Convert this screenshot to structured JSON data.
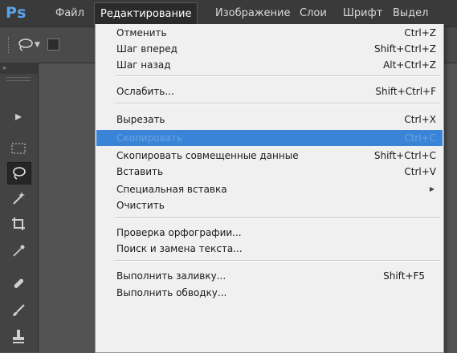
{
  "app": {
    "logo": "Ps"
  },
  "menubar": [
    "Файл",
    "Редактирование",
    "Изображение",
    "Слои",
    "Шрифт",
    "Выдел"
  ],
  "tool_panel": {
    "collapse": "»"
  },
  "tools": [
    {
      "icon": "move-tool-icon",
      "glyph": "▸"
    },
    {
      "icon": "marquee-tool-icon",
      "glyph": "⬚"
    },
    {
      "icon": "lasso-tool-icon",
      "glyph": "ℓ"
    },
    {
      "icon": "magic-wand-tool-icon",
      "glyph": "✶"
    },
    {
      "icon": "crop-tool-icon",
      "glyph": "⌗"
    },
    {
      "icon": "eyedropper-tool-icon",
      "glyph": "⁄"
    },
    {
      "icon": "healing-brush-tool-icon",
      "glyph": "✎"
    },
    {
      "icon": "brush-tool-icon",
      "glyph": "✐"
    },
    {
      "icon": "clone-stamp-tool-icon",
      "glyph": "⊥"
    }
  ],
  "edit_menu": {
    "items": [
      {
        "label": "Отменить",
        "shortcut": "Ctrl+Z"
      },
      {
        "label": "Шаг вперед",
        "shortcut": "Shift+Ctrl+Z"
      },
      {
        "label": "Шаг назад",
        "shortcut": "Alt+Ctrl+Z"
      },
      {
        "label": "Ослабить...",
        "shortcut": "Shift+Ctrl+F"
      },
      {
        "label": "Вырезать",
        "shortcut": "Ctrl+X"
      },
      {
        "label": "Скопировать",
        "shortcut": "Ctrl+C"
      },
      {
        "label": "Скопировать совмещенные данные",
        "shortcut": "Shift+Ctrl+C"
      },
      {
        "label": "Вставить",
        "shortcut": "Ctrl+V"
      },
      {
        "label": "Специальная вставка",
        "shortcut": ""
      },
      {
        "label": "Очистить",
        "shortcut": ""
      },
      {
        "label": "Проверка орфографии...",
        "shortcut": ""
      },
      {
        "label": "Поиск и замена текста...",
        "shortcut": ""
      },
      {
        "label": "Выполнить заливку...",
        "shortcut": "Shift+F5"
      },
      {
        "label": "Выполнить обводку...",
        "shortcut": ""
      }
    ],
    "highlighted": "Скопировать"
  },
  "colors": {
    "highlight": "#3a84d8",
    "menu_bg": "#f0f0f0",
    "logo": "#58a4e8"
  }
}
